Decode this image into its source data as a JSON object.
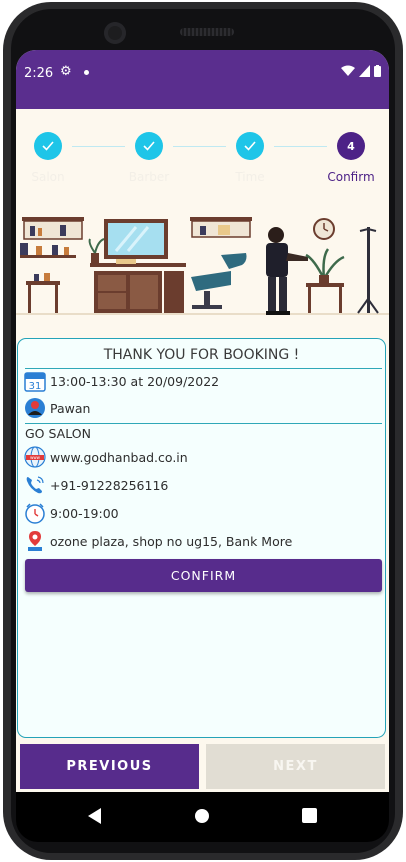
{
  "status_bar": {
    "time": "2:26"
  },
  "stepper": {
    "steps": [
      {
        "label": "Salon",
        "state": "done"
      },
      {
        "label": "Barber",
        "state": "done"
      },
      {
        "label": "Time",
        "state": "done"
      },
      {
        "label": "Confirm",
        "number": "4",
        "state": "active"
      }
    ]
  },
  "booking": {
    "title": "THANK YOU FOR BOOKING !",
    "datetime": "13:00-13:30 at 20/09/2022",
    "calendar_day": "31",
    "barber": "Pawan",
    "salon_name": "GO SALON",
    "website": "www.godhanbad.co.in",
    "phone": "+91-91228256116",
    "hours": "9:00-19:00",
    "address": "ozone plaza, shop no ug15, Bank More",
    "confirm_label": "CONFIRM"
  },
  "footer": {
    "previous_label": "PREVIOUS",
    "next_label": "NEXT"
  },
  "colors": {
    "primary": "#572c8c",
    "accent": "#1ec5e8",
    "card_border": "#24a3b8"
  }
}
